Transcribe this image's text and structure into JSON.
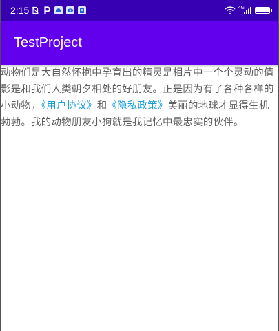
{
  "status_bar": {
    "time": "2:15",
    "network_label": "4G"
  },
  "icons": {
    "left": [
      "no-sim-icon",
      "parking-icon",
      "cloud-icon",
      "eye-icon",
      "document-icon"
    ],
    "right": [
      "wifi-icon",
      "signal-icon",
      "battery-icon"
    ]
  },
  "app_bar": {
    "title": "TestProject"
  },
  "content": {
    "text_before_user_agreement": "动物们是大自然怀抱中孕育出的精灵是相片中一个个灵动的倩影是和我们人类朝夕相处的好朋友。正是因为有了各种各样的小动物，",
    "user_agreement_link": "《用户协议》",
    "text_between": "和",
    "privacy_policy_link": "《隐私政策》",
    "text_after_privacy_policy": "美丽的地球才显得生机勃勃。我的动物朋友小狗就是我记忆中最忠实的伙伴。"
  },
  "colors": {
    "status_bar": "#3700b3",
    "app_bar": "#6200ee",
    "link": "#1a9fd8",
    "body_text": "#5f5f5f"
  }
}
